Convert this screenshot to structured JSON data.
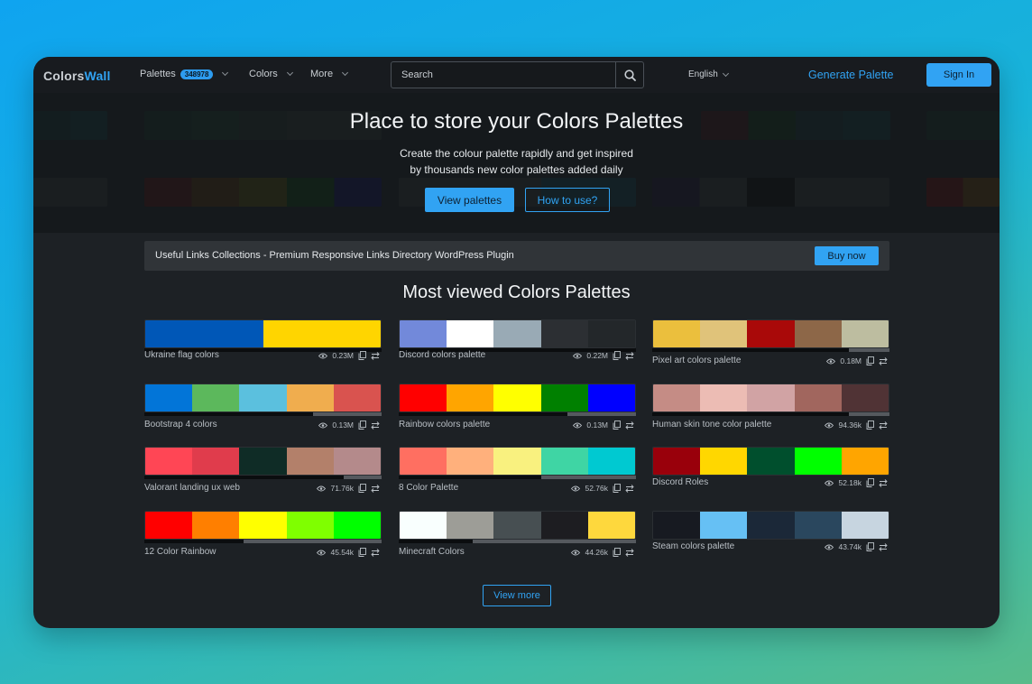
{
  "nav": {
    "logo_a": "Colors",
    "logo_b": "Wall",
    "palettes_label": "Palettes",
    "palettes_count": "348978",
    "colors_label": "Colors",
    "more_label": "More",
    "search_placeholder": "Search",
    "language": "English",
    "generate_label": "Generate Palette",
    "signin_label": "Sign In"
  },
  "hero": {
    "title": "Place to store your Colors Palettes",
    "subtitle_line1": "Create the colour palette rapidly and get inspired",
    "subtitle_line2": "by thousands new color palettes added daily",
    "view_palettes": "View palettes",
    "how_to_use": "How to use?"
  },
  "ad": {
    "text": "Useful Links Collections - Premium Responsive Links Directory WordPress Plugin",
    "button": "Buy now"
  },
  "section_title": "Most viewed Colors Palettes",
  "palettes": [
    {
      "name": "Ukraine flag colors",
      "views": "0.23M",
      "colors": [
        "#0057b7",
        "#ffd500"
      ],
      "progress": 1.0
    },
    {
      "name": "Discord colors palette",
      "views": "0.22M",
      "colors": [
        "#7289da",
        "#ffffff",
        "#99aab5",
        "#2c2f33",
        "#23272a"
      ],
      "progress": 1.0
    },
    {
      "name": "Pixel art colors palette",
      "views": "0.18M",
      "colors": [
        "#ebbf3d",
        "#e0c37a",
        "#a90909",
        "#8d6748",
        "#bdbda0"
      ],
      "progress": 0.83
    },
    {
      "name": "Bootstrap 4 colors",
      "views": "0.13M",
      "colors": [
        "#0275d8",
        "#5cb85c",
        "#5bc0de",
        "#f0ad4e",
        "#d9534f"
      ],
      "progress": 0.71
    },
    {
      "name": "Rainbow colors palette",
      "views": "0.13M",
      "colors": [
        "#ff0000",
        "#ffa500",
        "#ffff00",
        "#008000",
        "#0000ff"
      ],
      "progress": 0.71
    },
    {
      "name": "Human skin tone color palette",
      "views": "94.36k",
      "colors": [
        "#c58c85",
        "#ecbcb4",
        "#d1a3a4",
        "#a1665e",
        "#503335"
      ],
      "progress": 0.83
    },
    {
      "name": "Valorant landing ux web",
      "views": "71.76k",
      "colors": [
        "#ff4655",
        "#e03c4c",
        "#0f2c26",
        "#b3806a",
        "#b48a8b"
      ],
      "progress": 0.84
    },
    {
      "name": "8 Color Palette",
      "views": "52.76k",
      "colors": [
        "#ff6f61",
        "#ffb07c",
        "#f9f17f",
        "#3fd5a4",
        "#00c9d1"
      ],
      "progress": 0.6
    },
    {
      "name": "Discord Roles",
      "views": "52.18k",
      "colors": [
        "#99000b",
        "#ffd700",
        "#004f2d",
        "#00ff00",
        "#ffa500"
      ],
      "progress": 0.0
    },
    {
      "name": "12 Color Rainbow",
      "views": "45.54k",
      "colors": [
        "#ff0000",
        "#ff7f00",
        "#ffff00",
        "#7fff00",
        "#00ff00"
      ],
      "progress": 0.42
    },
    {
      "name": "Minecraft Colors",
      "views": "44.26k",
      "colors": [
        "#f9fffe",
        "#9d9d97",
        "#474f52",
        "#1d1d21",
        "#fed83d"
      ],
      "progress": 0.31
    },
    {
      "name": "Steam colors palette",
      "views": "43.74k",
      "colors": [
        "#171a21",
        "#66c0f4",
        "#1b2838",
        "#2a475e",
        "#c7d5e0"
      ],
      "progress": 0.0
    }
  ],
  "view_more": "View more"
}
